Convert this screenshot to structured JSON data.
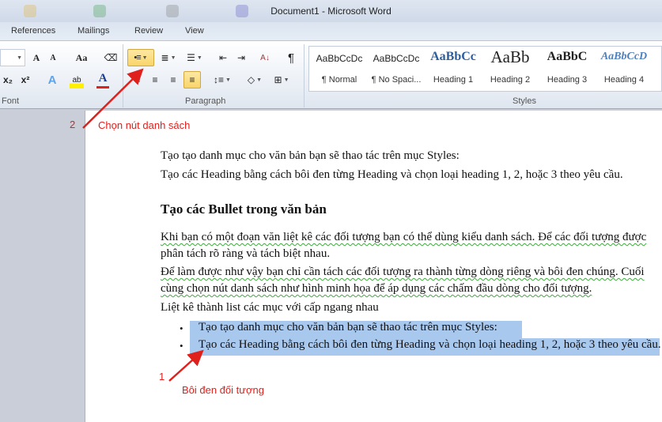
{
  "window": {
    "title": "Document1  -  Microsoft Word"
  },
  "tabs": [
    "References",
    "Mailings",
    "Review",
    "View"
  ],
  "ribbon": {
    "groups": {
      "font": "Font",
      "paragraph": "Paragraph",
      "styles": "Styles"
    },
    "font_buttons": {
      "grow": "A",
      "shrink": "A",
      "case": "Aa",
      "subscript": "x₂",
      "superscript": "x²",
      "effects": "A",
      "highlight": "ab",
      "color": "A"
    },
    "paragraph_buttons": {
      "pilcrow": "¶",
      "sort": "A↓"
    },
    "styles": [
      {
        "preview": "AaBbCcDc",
        "name": "¶ Normal"
      },
      {
        "preview": "AaBbCcDc",
        "name": "¶ No Spaci..."
      },
      {
        "preview": "AaBbCc",
        "name": "Heading 1"
      },
      {
        "preview": "AaBb",
        "name": "Heading 2"
      },
      {
        "preview": "AaBbC",
        "name": "Heading 3"
      },
      {
        "preview": "AaBbCcD",
        "name": "Heading 4"
      }
    ],
    "accent_highlight": "#f9d469"
  },
  "document": {
    "line1": "Tạo tạo danh mục cho văn bản bạn sẽ thao tác trên mục Styles:",
    "line2": "Tạo các Heading bằng cách bôi đen từng Heading và chọn loại heading 1, 2, hoặc 3 theo yêu cầu.",
    "heading": "Tạo các Bullet trong văn bản",
    "para1a": "Khi bạn có một đoạn văn liệt kê các đối tượng bạn có thể dùng kiểu danh sách. Để các đối tượng được",
    "para1b": "phân tách rõ ràng và tách biệt nhau.",
    "para2a": "Để làm được như vậy bạn chỉ cần tách các đối tượng ra thành từng dòng riêng và bôi đen chúng. Cuối",
    "para2b": "cùng chọn nút danh sách như hình minh họa để áp dụng các chấm đầu dòng cho đối tượng.",
    "list_intro": "Liệt kê thành list các mục với cấp ngang nhau",
    "bullets": [
      "Tạo tạo danh mục cho văn bản bạn sẽ thao tác trên mục Styles:",
      "Tạo các Heading bằng cách bôi đen từng Heading và chọn loại heading 1, 2, hoặc 3 theo yêu cầu."
    ],
    "bullet_char": "•",
    "selection_color": "#a9c8ee"
  },
  "annotations": {
    "step2_number": "2",
    "step2_text": "Chọn nút danh sách",
    "step1_number": "1",
    "step1_text": "Bôi đen đối tượng",
    "color": "#e0201c"
  }
}
